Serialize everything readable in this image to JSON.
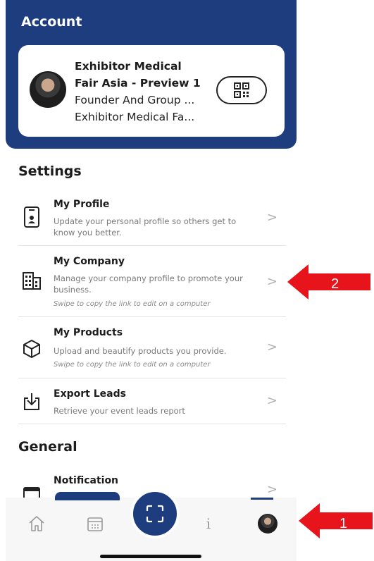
{
  "header": {
    "title": "Account"
  },
  "profile": {
    "name": "Exhibitor Medical Fair Asia - Preview 1",
    "name_line1": "Exhibitor Medical",
    "name_line2": "Fair Asia - Preview 1",
    "role": "Founder And Group ...",
    "company": "Exhibitor Medical Fa...",
    "qr_icon": "qr-code-icon"
  },
  "settings": {
    "title": "Settings",
    "items": [
      {
        "title": "My Profile",
        "desc": "Update your personal profile so others get to know you better.",
        "icon": "id-badge-icon"
      },
      {
        "title": "My Company",
        "desc": "Manage your company profile to promote your business.",
        "hint": "Swipe to copy the link to edit on a computer",
        "icon": "building-icon"
      },
      {
        "title": "My Products",
        "desc": "Upload and beautify products you provide.",
        "hint": "Swipe to copy the link to edit on a computer",
        "icon": "box-icon"
      },
      {
        "title": "Export Leads",
        "desc": "Retrieve your event leads report",
        "icon": "download-icon"
      }
    ]
  },
  "general": {
    "title": "General",
    "items": [
      {
        "title": "Notification",
        "icon": "calendar-icon"
      }
    ]
  },
  "tabbar": {
    "items": [
      "home-icon",
      "calendar-icon",
      "scan-icon",
      "info-icon",
      "avatar"
    ],
    "info_glyph": "i"
  },
  "annotations": [
    {
      "label": "1"
    },
    {
      "label": "2"
    }
  ],
  "colors": {
    "brand": "#1d3d7f",
    "annotation": "#e8141b"
  }
}
